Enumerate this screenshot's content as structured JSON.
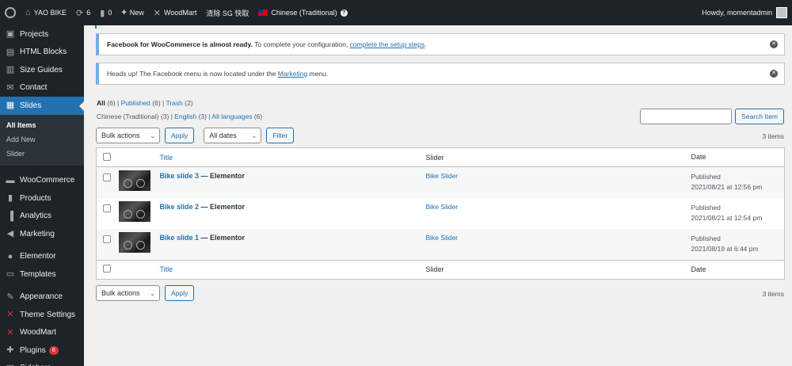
{
  "adminbar": {
    "site_name": "YAO BIKE",
    "updates_count": "6",
    "comments_count": "0",
    "new_label": "New",
    "woodmart_label": "WoodMart",
    "cache_label": "清除 SG 快取",
    "language_label": "Chinese (Traditional)",
    "howdy": "Howdy, momentadmin"
  },
  "sidebar": {
    "items_top": [
      {
        "label": "Projects",
        "icon": "▣"
      },
      {
        "label": "HTML Blocks",
        "icon": "▤"
      },
      {
        "label": "Size Guides",
        "icon": "▥"
      },
      {
        "label": "Contact",
        "icon": "✉"
      }
    ],
    "current": {
      "label": "Slides",
      "icon": "▦"
    },
    "submenu": [
      "All Items",
      "Add New",
      "Slider"
    ],
    "items_mid": [
      {
        "label": "WooCommerce",
        "icon": "▬"
      },
      {
        "label": "Products",
        "icon": "▮"
      },
      {
        "label": "Analytics",
        "icon": "▐"
      },
      {
        "label": "Marketing",
        "icon": "◀"
      }
    ],
    "items_el": [
      {
        "label": "Elementor",
        "icon": "●"
      },
      {
        "label": "Templates",
        "icon": "▭"
      }
    ],
    "items_bottom": [
      {
        "label": "Appearance",
        "icon": "✎"
      },
      {
        "label": "Theme Settings",
        "icon": "✕"
      },
      {
        "label": "WoodMart",
        "icon": "✕"
      },
      {
        "label": "Plugins",
        "icon": "✚",
        "badge": "6"
      },
      {
        "label": "Sidebars",
        "icon": "▤"
      }
    ]
  },
  "notices": {
    "facebook_bold": "Facebook for WooCommerce is almost ready.",
    "facebook_text": " To complete your configuration, ",
    "facebook_link": "complete the setup steps",
    "facebook_end": ".",
    "menu_text": "Heads up! The Facebook menu is now located under the ",
    "menu_link": "Marketing",
    "menu_end": " menu."
  },
  "views": {
    "all": "All",
    "all_count": "(6)",
    "published": "Published",
    "published_count": "(6)",
    "trash": "Trash",
    "trash_count": "(2)"
  },
  "languages": {
    "chinese": "Chinese (Traditional)",
    "chinese_count": "(3)",
    "english": "English",
    "english_count": "(3)",
    "all": "All languages",
    "all_count": "(6)"
  },
  "toolbar": {
    "bulk_actions": "Bulk actions",
    "apply": "Apply",
    "all_dates": "All dates",
    "filter": "Filter",
    "search_button": "Search Item",
    "items_count": "3 items"
  },
  "table": {
    "headers": {
      "title": "Title",
      "slider": "Slider",
      "date": "Date"
    },
    "rows": [
      {
        "title": "Bike slide 3",
        "state": " — Elementor",
        "slider": "Bike Slider",
        "status": "Published",
        "date": "2021/08/21 at 12:56 pm"
      },
      {
        "title": "Bike slide 2",
        "state": " — Elementor",
        "slider": "Bike Slider",
        "status": "Published",
        "date": "2021/08/21 at 12:54 pm"
      },
      {
        "title": "Bike slide 1",
        "state": " — Elementor",
        "slider": "Bike Slider",
        "status": "Published",
        "date": "2021/08/19 at 6:44 pm"
      }
    ]
  }
}
